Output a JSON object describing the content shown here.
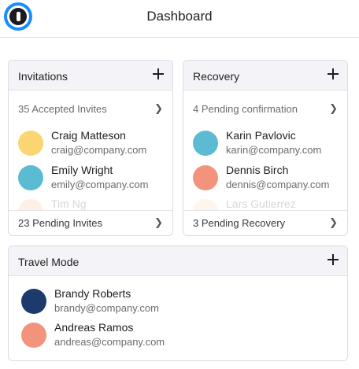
{
  "header": {
    "title": "Dashboard",
    "logo": "1password-logo"
  },
  "colors": {
    "yellow": "#fcd573",
    "teal": "#5bbbd3",
    "salmon": "#f2947c",
    "peach": "#fbd3b8",
    "cream": "#fde6c8",
    "navy": "#1c3a6b"
  },
  "invitations": {
    "title": "Invitations",
    "accepted": "35 Accepted Invites",
    "people": [
      {
        "name": "Craig Matteson",
        "email": "craig@company.com",
        "color": "#fcd573"
      },
      {
        "name": "Emily Wright",
        "email": "emily@company.com",
        "color": "#5bbbd3"
      },
      {
        "name": "Tim Ng",
        "color": "#fbd3b8"
      }
    ],
    "pending": "23 Pending Invites"
  },
  "recovery": {
    "title": "Recovery",
    "pending_confirmation": "4 Pending confirmation",
    "people": [
      {
        "name": "Karin Pavlovic",
        "email": "karin@company.com",
        "color": "#5bbbd3"
      },
      {
        "name": "Dennis Birch",
        "email": "dennis@company.com",
        "color": "#f2947c"
      },
      {
        "name": "Lars Gutierrez",
        "color": "#fde6c8"
      }
    ],
    "pending": "3 Pending Recovery"
  },
  "travel_mode": {
    "title": "Travel Mode",
    "people": [
      {
        "name": "Brandy Roberts",
        "email": "brandy@company.com",
        "color": "#1c3a6b"
      },
      {
        "name": "Andreas Ramos",
        "email": "andreas@company.com",
        "color": "#f2947c"
      }
    ]
  },
  "icons": {
    "add": "plus-icon",
    "chevron": "chevron-right-icon"
  },
  "glyphs": {
    "chevron": "❯"
  }
}
